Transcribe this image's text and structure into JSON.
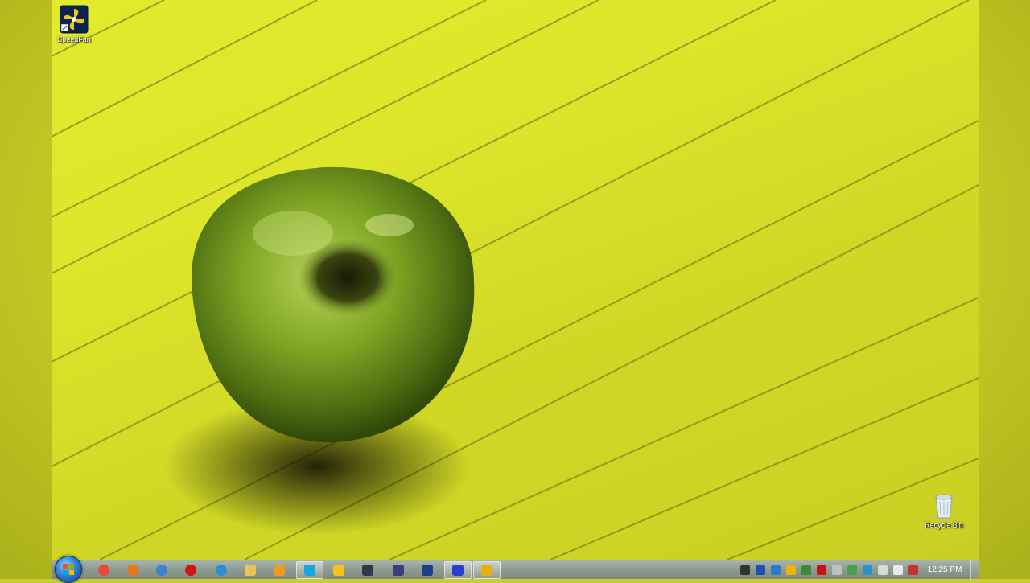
{
  "desktop": {
    "icons": [
      {
        "label": "SpeedFan",
        "icon": "speedfan-fan-icon"
      },
      {
        "label": "Recycle Bin",
        "icon": "recycle-bin-icon"
      }
    ]
  },
  "taskbar": {
    "start_icon": "windows-start-orb",
    "pinned": [
      {
        "name": "chrome-icon",
        "color": "#e94b35"
      },
      {
        "name": "firefox-icon",
        "color": "#e8771e"
      },
      {
        "name": "globe-icon",
        "color": "#3d7fd0"
      },
      {
        "name": "opera-icon",
        "color": "#d0141a"
      },
      {
        "name": "internet-explorer-icon",
        "color": "#2a8fd8"
      },
      {
        "name": "folder-icon",
        "color": "#e8c45a"
      },
      {
        "name": "media-player-icon",
        "color": "#f09a1e"
      },
      {
        "name": "skype-icon",
        "color": "#17a7e0",
        "active": true
      },
      {
        "name": "smiley-icon",
        "color": "#f3c316"
      },
      {
        "name": "camera-icon",
        "color": "#2b3a4a"
      },
      {
        "name": "after-effects-icon",
        "color": "#3b3f7a"
      },
      {
        "name": "photoshop-icon",
        "color": "#1e3f8a"
      },
      {
        "name": "screen-recorder-icon",
        "color": "#2b3fd0",
        "active": true
      },
      {
        "name": "winamp-icon",
        "color": "#e3b20e",
        "active": true
      }
    ]
  },
  "tray": {
    "icons": [
      "network-icon",
      "monitor-icon",
      "steam-icon",
      "figure-icon",
      "windows-flag-icon",
      "adobe-icon",
      "tools-icon",
      "color-grid-icon",
      "gear-icon",
      "display-icon",
      "volume-icon",
      "flag-icon"
    ],
    "clock": "12:25 PM"
  }
}
